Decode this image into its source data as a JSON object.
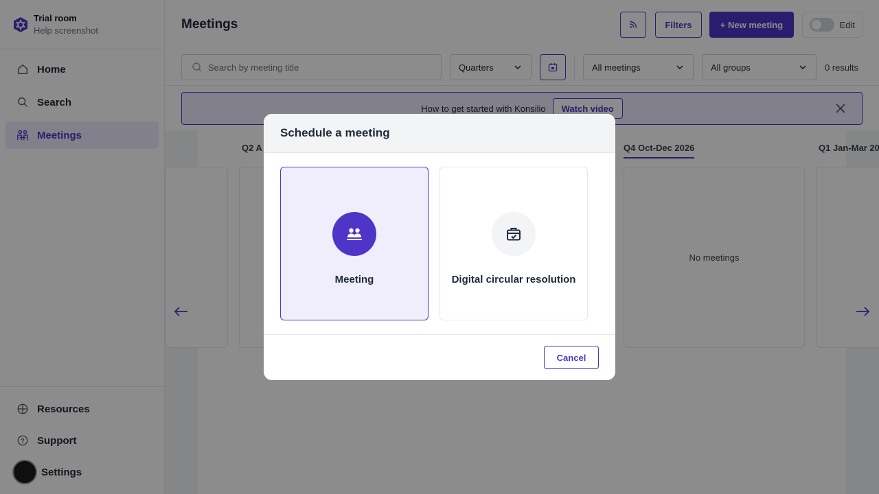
{
  "colors": {
    "accent": "#4f35c7",
    "accent_light": "#ede9fe",
    "overlay": "rgba(0,0,0,0.45)"
  },
  "room": {
    "name": "Trial room",
    "subtitle": "Help screenshot"
  },
  "sidebar": {
    "items": [
      {
        "label": "Home",
        "icon": "home-icon"
      },
      {
        "label": "Search",
        "icon": "search-icon"
      },
      {
        "label": "Meetings",
        "icon": "meetings-icon",
        "active": true
      }
    ],
    "bottom_items": [
      {
        "label": "Resources",
        "icon": "globe-icon"
      },
      {
        "label": "Support",
        "icon": "help-icon"
      },
      {
        "label": "Settings",
        "icon": "avatar"
      }
    ]
  },
  "header": {
    "title": "Meetings",
    "filters_label": "Filters",
    "new_meeting_label": "+ New meeting",
    "edit_label": "Edit"
  },
  "toolbar": {
    "search_placeholder": "Search by meeting title",
    "period_select": "Quarters",
    "meetings_select": "All meetings",
    "groups_select": "All groups",
    "results": "0 results"
  },
  "banner": {
    "text": "How to get started with Konsilio",
    "button": "Watch video"
  },
  "board": {
    "columns": [
      {
        "label": "Q2 A",
        "prefix": "Q2",
        "rest": "A"
      },
      {
        "label": "Q4 Oct-Dec 2026",
        "prefix": "Q4",
        "rest": "Oct-Dec 2026",
        "empty_text": "No meetings"
      },
      {
        "label": "Q1 Jan-Mar 20",
        "prefix": "Q1",
        "rest": "Jan-Mar 20"
      }
    ]
  },
  "modal": {
    "title": "Schedule a meeting",
    "options": [
      {
        "label": "Meeting",
        "icon": "people-icon",
        "selected": true
      },
      {
        "label": "Digital circular resolution",
        "icon": "briefcase-check-icon",
        "selected": false
      }
    ],
    "cancel_label": "Cancel"
  }
}
